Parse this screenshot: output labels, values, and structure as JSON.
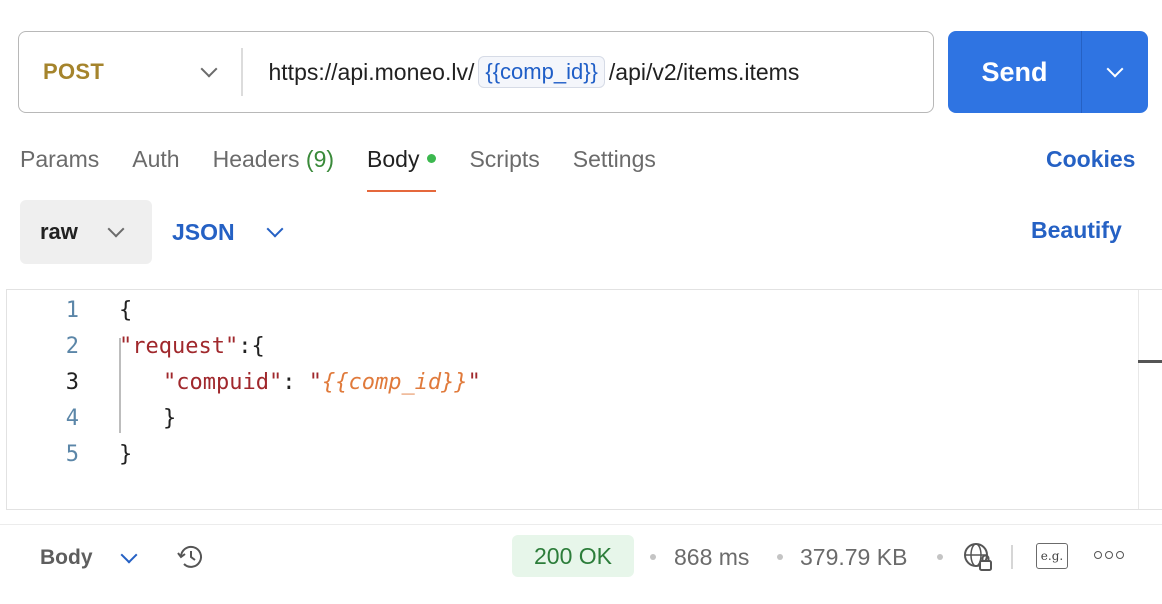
{
  "request": {
    "method": "POST",
    "url_prefix": "https://api.moneo.lv/",
    "url_variable": "{{comp_id}}",
    "url_suffix": "/api/v2/items.items",
    "send_label": "Send"
  },
  "tabs": [
    {
      "label": "Params"
    },
    {
      "label": "Auth"
    },
    {
      "label": "Headers",
      "count": "(9)"
    },
    {
      "label": "Body",
      "active": true
    },
    {
      "label": "Scripts"
    },
    {
      "label": "Settings"
    }
  ],
  "cookies_label": "Cookies",
  "body_options": {
    "mode": "raw",
    "language": "JSON",
    "beautify_label": "Beautify"
  },
  "editor": {
    "line_numbers": [
      "1",
      "2",
      "3",
      "4",
      "5"
    ],
    "lines": {
      "l1": "{",
      "l2_key": "\"request\"",
      "l2_rest": ":{",
      "l3_key": "\"compuid\"",
      "l3_colon": ": ",
      "l3_q1": "\"",
      "l3_val": "{{comp_id}}",
      "l3_q2": "\"",
      "l4": "}",
      "l5": "}"
    }
  },
  "status_bar": {
    "view_label": "Body",
    "status": "200 OK",
    "time": "868 ms",
    "size": "379.79 KB",
    "example_icon_text": "e.g."
  },
  "colors": {
    "accent": "#2f74e2",
    "method": "#a5842c",
    "active_tab_underline": "#e5683c",
    "status_ok_bg": "#e7f6ea",
    "status_ok_text": "#2c7d3a"
  }
}
